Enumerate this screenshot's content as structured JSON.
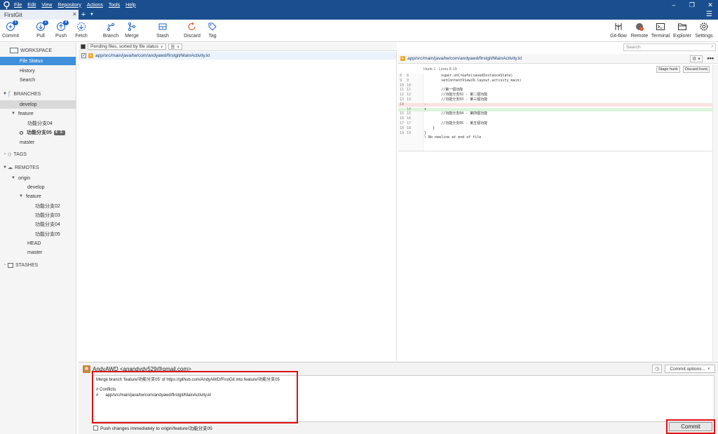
{
  "menubar": {
    "items": [
      "File",
      "Edit",
      "View",
      "Repository",
      "Actions",
      "Tools",
      "Help"
    ]
  },
  "window": {
    "minimize": "–",
    "restore": "❐",
    "close": "✕"
  },
  "tabs": [
    {
      "label": "FirstGit"
    }
  ],
  "toolbar": {
    "left": [
      {
        "label": "Commit",
        "icon": "commit-icon",
        "badge": "1"
      },
      {
        "label": "Pull",
        "icon": "pull-icon",
        "badge": "1"
      },
      {
        "label": "Push",
        "icon": "push-icon",
        "badge": "4"
      },
      {
        "label": "Fetch",
        "icon": "fetch-icon"
      },
      {
        "label": "Branch",
        "icon": "branch-icon"
      },
      {
        "label": "Merge",
        "icon": "merge-icon"
      },
      {
        "label": "Stash",
        "icon": "stash-icon"
      },
      {
        "label": "Discard",
        "icon": "discard-icon"
      },
      {
        "label": "Tag",
        "icon": "tag-icon"
      }
    ],
    "right": [
      {
        "label": "Git-flow",
        "icon": "gitflow-icon"
      },
      {
        "label": "Remote",
        "icon": "remote-icon"
      },
      {
        "label": "Terminal",
        "icon": "terminal-icon"
      },
      {
        "label": "Explorer",
        "icon": "explorer-icon"
      },
      {
        "label": "Settings",
        "icon": "settings-icon"
      }
    ]
  },
  "search": {
    "placeholder": "Search"
  },
  "sidebar": {
    "workspace": "WORKSPACE",
    "workspace_items": [
      "File Status",
      "History",
      "Search"
    ],
    "branches_header": "BRANCHES",
    "branches": {
      "develop": "develop",
      "feature": "feature",
      "feature04": "功能分支04",
      "feature05": "功能分支05",
      "feature05_badge": "4↑ 3↓",
      "master": "master"
    },
    "tags_header": "TAGS",
    "remotes_header": "REMOTES",
    "remotes": {
      "origin": "origin",
      "develop": "develop",
      "feature": "feature",
      "f02": "功能分支02",
      "f03": "功能分支03",
      "f04": "功能分支04",
      "f05": "功能分支05",
      "head": "HEAD",
      "master": "master"
    },
    "stashes_header": "STASHES"
  },
  "filepane": {
    "sort_label": "Pending files, sorted by file status",
    "view_label": "☰",
    "files": [
      {
        "path": "app/src/main/java/tw/com/andyawd/firstgit/MainActivity.kt",
        "checked": true
      }
    ]
  },
  "diff": {
    "path": "app/src/main/java/tw/com/andyawd/firstgit/MainActivity.kt",
    "hunk_label": "Hunk 1 : Lines 8-19",
    "stage_hunk": "Stage hunk",
    "discard_hunk": "Discard hunk",
    "lines": [
      {
        "o": "8",
        "n": "8",
        "t": "        super.onCreate(savedInstanceState)",
        "k": "ctx"
      },
      {
        "o": "9",
        "n": "9",
        "t": "        setContentView(R.layout.activity_main)",
        "k": "ctx"
      },
      {
        "o": "10",
        "n": "10",
        "t": "",
        "k": "ctx"
      },
      {
        "o": "11",
        "n": "11",
        "t": "        //第一個功能",
        "k": "ctx"
      },
      {
        "o": "12",
        "n": "12",
        "t": "        //功能分支02 - 第二個功能",
        "k": "ctx"
      },
      {
        "o": "13",
        "n": "13",
        "t": "        //功能分支03 - 第三個功能",
        "k": "ctx"
      },
      {
        "o": "14",
        "n": "",
        "t": "-",
        "k": "del"
      },
      {
        "o": "",
        "n": "14",
        "t": "+",
        "k": "add"
      },
      {
        "o": "15",
        "n": "15",
        "t": "        //功能分支04 - 第四個功能",
        "k": "ctx"
      },
      {
        "o": "16",
        "n": "16",
        "t": "",
        "k": "ctx"
      },
      {
        "o": "17",
        "n": "17",
        "t": "        //功能分支05 - 第五個功能",
        "k": "ctx"
      },
      {
        "o": "18",
        "n": "18",
        "t": "    }",
        "k": "ctx"
      },
      {
        "o": "19",
        "n": "19",
        "t": "}",
        "k": "ctx"
      },
      {
        "o": "",
        "n": "",
        "t": "\\ No newline at end of file",
        "k": "ctx"
      }
    ]
  },
  "commit": {
    "author": "AndyAWD <anandydy529@gmail.com>",
    "options_label": "Commit options...",
    "message": "Merge branch 'feature/功能分支05' of https://github.com/AndyAWD/FirstGit into feature/功能分支05\n\n# Conflicts:\n#\tapp/src/main/java/tw/com/andyawd/firstgit/MainActivity.kt",
    "push_label": "Push changes immediately to origin/feature/功能分支05",
    "commit_button": "Commit"
  }
}
